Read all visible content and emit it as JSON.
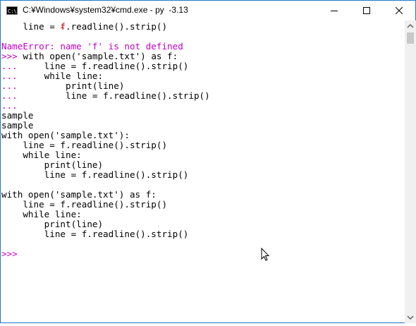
{
  "window": {
    "title": "C:¥Windows¥system32¥cmd.exe - py  -3.13",
    "icon": "cmd-icon",
    "controls": [
      "minimize-icon",
      "maximize-icon",
      "close-icon"
    ]
  },
  "console": {
    "lines": [
      {
        "text": "    line = f.readline().strip()",
        "style": "normal",
        "error_marker": true
      },
      {
        "text": "",
        "style": "normal"
      },
      {
        "text": "NameError: name 'f' is not defined",
        "style": "magenta"
      },
      {
        "prompt": ">>> ",
        "text": "with open('sample.txt') as f:",
        "style": "prompt"
      },
      {
        "prompt": "... ",
        "text": "    line = f.readline().strip()",
        "style": "prompt"
      },
      {
        "prompt": "... ",
        "text": "    while line:",
        "style": "prompt"
      },
      {
        "prompt": "... ",
        "text": "        print(line)",
        "style": "prompt"
      },
      {
        "prompt": "... ",
        "text": "        line = f.readline().strip()",
        "style": "prompt"
      },
      {
        "prompt": "... ",
        "text": "",
        "style": "prompt"
      },
      {
        "text": "sample",
        "style": "normal"
      },
      {
        "text": "sample",
        "style": "normal"
      },
      {
        "text": "with open('sample.txt'):",
        "style": "normal"
      },
      {
        "text": "    line = f.readline().strip()",
        "style": "normal"
      },
      {
        "text": "    while line:",
        "style": "normal"
      },
      {
        "text": "        print(line)",
        "style": "normal"
      },
      {
        "text": "        line = f.readline().strip()",
        "style": "normal"
      },
      {
        "text": "",
        "style": "normal"
      },
      {
        "text": "with open('sample.txt') as f:",
        "style": "normal"
      },
      {
        "text": "    line = f.readline().strip()",
        "style": "normal"
      },
      {
        "text": "    while line:",
        "style": "normal"
      },
      {
        "text": "        print(line)",
        "style": "normal"
      },
      {
        "text": "        line = f.readline().strip()",
        "style": "normal"
      },
      {
        "text": "",
        "style": "normal"
      },
      {
        "prompt": ">>> ",
        "text": "",
        "style": "prompt"
      }
    ]
  },
  "colors": {
    "prompt": "#c000c0",
    "error": "#c00000",
    "text": "#000000",
    "background": "#ffffff"
  },
  "scrollbar": {
    "up_icon": "scroll-up-arrow-icon",
    "down_icon": "scroll-down-arrow-icon"
  },
  "mouse_cursor": "mouse-pointer-icon"
}
